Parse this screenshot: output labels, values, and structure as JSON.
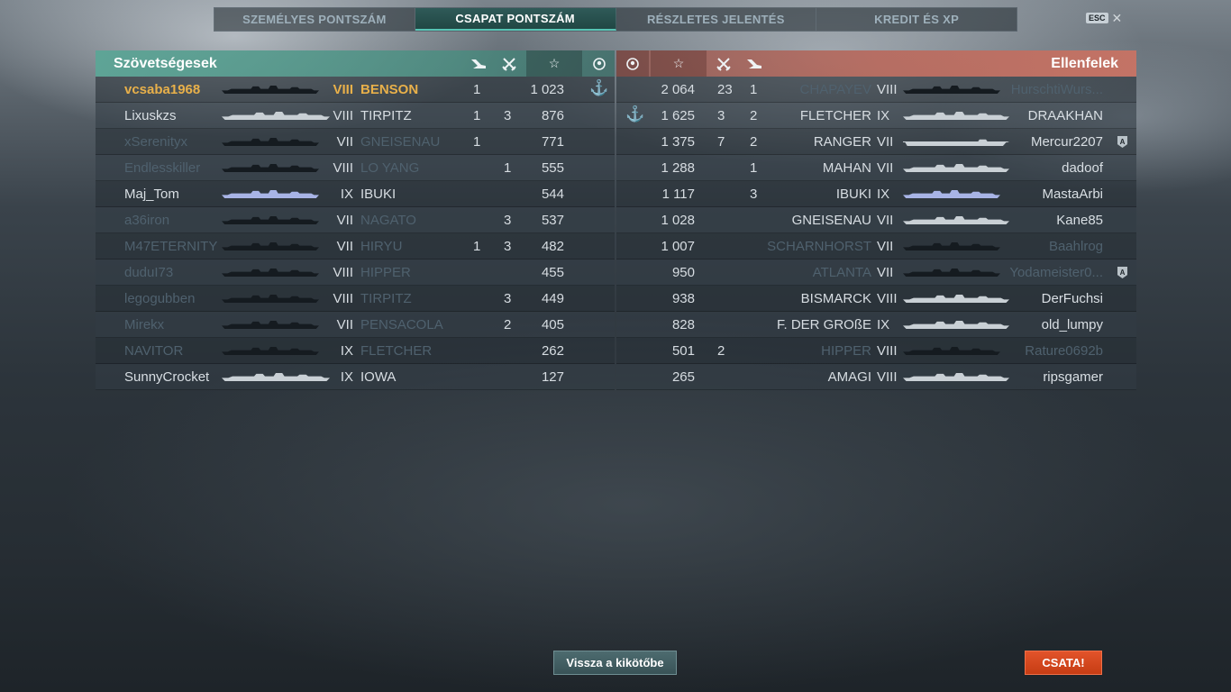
{
  "tabs": [
    {
      "label": "SZEMÉLYES PONTSZÁM",
      "active": false
    },
    {
      "label": "CSAPAT PONTSZÁM",
      "active": true
    },
    {
      "label": "RÉSZLETES JELENTÉS",
      "active": false
    },
    {
      "label": "KREDIT ÉS XP",
      "active": false
    }
  ],
  "esc": {
    "key_label": "ESC",
    "close_icon": "✕"
  },
  "allies": {
    "title": "Szövetségesek",
    "header_icons": [
      "plane-icon",
      "crossed-swords-icon",
      "star-icon",
      "laurel-emblem-icon"
    ],
    "rows": [
      {
        "player": "vcsaba1968",
        "tier": "VIII",
        "ship": "BENSON",
        "planes": "1",
        "kills": "",
        "score": "1 023",
        "anchor": true,
        "self": true,
        "dim": false,
        "sil": "dark"
      },
      {
        "player": "Lixuskzs",
        "tier": "VIII",
        "ship": "TIRPITZ",
        "planes": "1",
        "kills": "3",
        "score": "876",
        "anchor": false,
        "self": false,
        "dim": false,
        "sil": "light"
      },
      {
        "player": "xSerenityx",
        "tier": "VII",
        "ship": "GNEISENAU",
        "planes": "1",
        "kills": "",
        "score": "771",
        "anchor": false,
        "self": false,
        "dim": true,
        "sil": "dark"
      },
      {
        "player": "Endlesskiller",
        "tier": "VIII",
        "ship": "LO YANG",
        "planes": "",
        "kills": "1",
        "score": "555",
        "anchor": false,
        "self": false,
        "dim": true,
        "sil": "dark"
      },
      {
        "player": "Maj_Tom",
        "tier": "IX",
        "ship": "IBUKI",
        "planes": "",
        "kills": "",
        "score": "544",
        "anchor": false,
        "self": false,
        "dim": false,
        "sil": "blue"
      },
      {
        "player": "a36iron",
        "tier": "VII",
        "ship": "NAGATO",
        "planes": "",
        "kills": "3",
        "score": "537",
        "anchor": false,
        "self": false,
        "dim": true,
        "sil": "dark"
      },
      {
        "player": "M47ETERNITY",
        "tier": "VII",
        "ship": "HIRYU",
        "planes": "1",
        "kills": "3",
        "score": "482",
        "anchor": false,
        "self": false,
        "dim": true,
        "sil": "dark"
      },
      {
        "player": "duduI73",
        "tier": "VIII",
        "ship": "HIPPER",
        "planes": "",
        "kills": "",
        "score": "455",
        "anchor": false,
        "self": false,
        "dim": true,
        "sil": "dark"
      },
      {
        "player": "legogubben",
        "tier": "VIII",
        "ship": "TIRPITZ",
        "planes": "",
        "kills": "3",
        "score": "449",
        "anchor": false,
        "self": false,
        "dim": true,
        "sil": "dark"
      },
      {
        "player": "Mirekx",
        "tier": "VII",
        "ship": "PENSACOLA",
        "planes": "",
        "kills": "2",
        "score": "405",
        "anchor": false,
        "self": false,
        "dim": true,
        "sil": "dark"
      },
      {
        "player": "NAVITOR",
        "tier": "IX",
        "ship": "FLETCHER",
        "planes": "",
        "kills": "",
        "score": "262",
        "anchor": false,
        "self": false,
        "dim": true,
        "sil": "dark"
      },
      {
        "player": "SunnyCrocket",
        "tier": "IX",
        "ship": "IOWA",
        "planes": "",
        "kills": "",
        "score": "127",
        "anchor": false,
        "self": false,
        "dim": false,
        "sil": "light"
      }
    ]
  },
  "enemies": {
    "title": "Ellenfelek",
    "header_icons": [
      "laurel-emblem-icon",
      "star-icon",
      "crossed-swords-icon",
      "plane-icon"
    ],
    "rows": [
      {
        "player": "HurschtiWurs...",
        "tier": "VIII",
        "ship": "CHAPAYEV",
        "planes": "1",
        "kills": "23",
        "score": "2 064",
        "anchor": false,
        "badge": false,
        "dim": true,
        "sil": "dark"
      },
      {
        "player": "DRAAKHAN",
        "tier": "IX",
        "ship": "FLETCHER",
        "planes": "2",
        "kills": "3",
        "score": "1 625",
        "anchor": true,
        "badge": false,
        "dim": false,
        "sil": "light"
      },
      {
        "player": "Mercur2207",
        "tier": "VII",
        "ship": "RANGER",
        "planes": "2",
        "kills": "7",
        "score": "1 375",
        "anchor": false,
        "badge": true,
        "dim": false,
        "sil": "light"
      },
      {
        "player": "dadoof",
        "tier": "VII",
        "ship": "MAHAN",
        "planes": "1",
        "kills": "",
        "score": "1 288",
        "anchor": false,
        "badge": false,
        "dim": false,
        "sil": "light"
      },
      {
        "player": "MastaArbi",
        "tier": "IX",
        "ship": "IBUKI",
        "planes": "3",
        "kills": "",
        "score": "1 117",
        "anchor": false,
        "badge": false,
        "dim": false,
        "sil": "blue"
      },
      {
        "player": "Kane85",
        "tier": "VII",
        "ship": "GNEISENAU",
        "planes": "",
        "kills": "",
        "score": "1 028",
        "anchor": false,
        "badge": false,
        "dim": false,
        "sil": "light"
      },
      {
        "player": "Baahlrog",
        "tier": "VII",
        "ship": "SCHARNHORST",
        "planes": "",
        "kills": "",
        "score": "1 007",
        "anchor": false,
        "badge": false,
        "dim": true,
        "sil": "dark"
      },
      {
        "player": "Yodameister0...",
        "tier": "VII",
        "ship": "ATLANTA",
        "planes": "",
        "kills": "",
        "score": "950",
        "anchor": false,
        "badge": true,
        "dim": true,
        "sil": "dark"
      },
      {
        "player": "DerFuchsi",
        "tier": "VIII",
        "ship": "BISMARCK",
        "planes": "",
        "kills": "",
        "score": "938",
        "anchor": false,
        "badge": false,
        "dim": false,
        "sil": "light"
      },
      {
        "player": "old_lumpy",
        "tier": "IX",
        "ship": "F. DER GROßE",
        "planes": "",
        "kills": "",
        "score": "828",
        "anchor": false,
        "badge": false,
        "dim": false,
        "sil": "light"
      },
      {
        "player": "Rature0692b",
        "tier": "VIII",
        "ship": "HIPPER",
        "planes": "",
        "kills": "2",
        "score": "501",
        "anchor": false,
        "badge": false,
        "dim": true,
        "sil": "dark"
      },
      {
        "player": "ripsgamer",
        "tier": "VIII",
        "ship": "AMAGI",
        "planes": "",
        "kills": "",
        "score": "265",
        "anchor": false,
        "badge": false,
        "dim": false,
        "sil": "light"
      }
    ]
  },
  "buttons": {
    "back": "Vissza a kikötőbe",
    "battle": "CSATA!"
  },
  "colors": {
    "self": "#e8b04a",
    "anchor": "#e3b23c",
    "allies_header": "#5ca596",
    "enemies_header": "#c87364",
    "battle_button": "#d9481f"
  }
}
